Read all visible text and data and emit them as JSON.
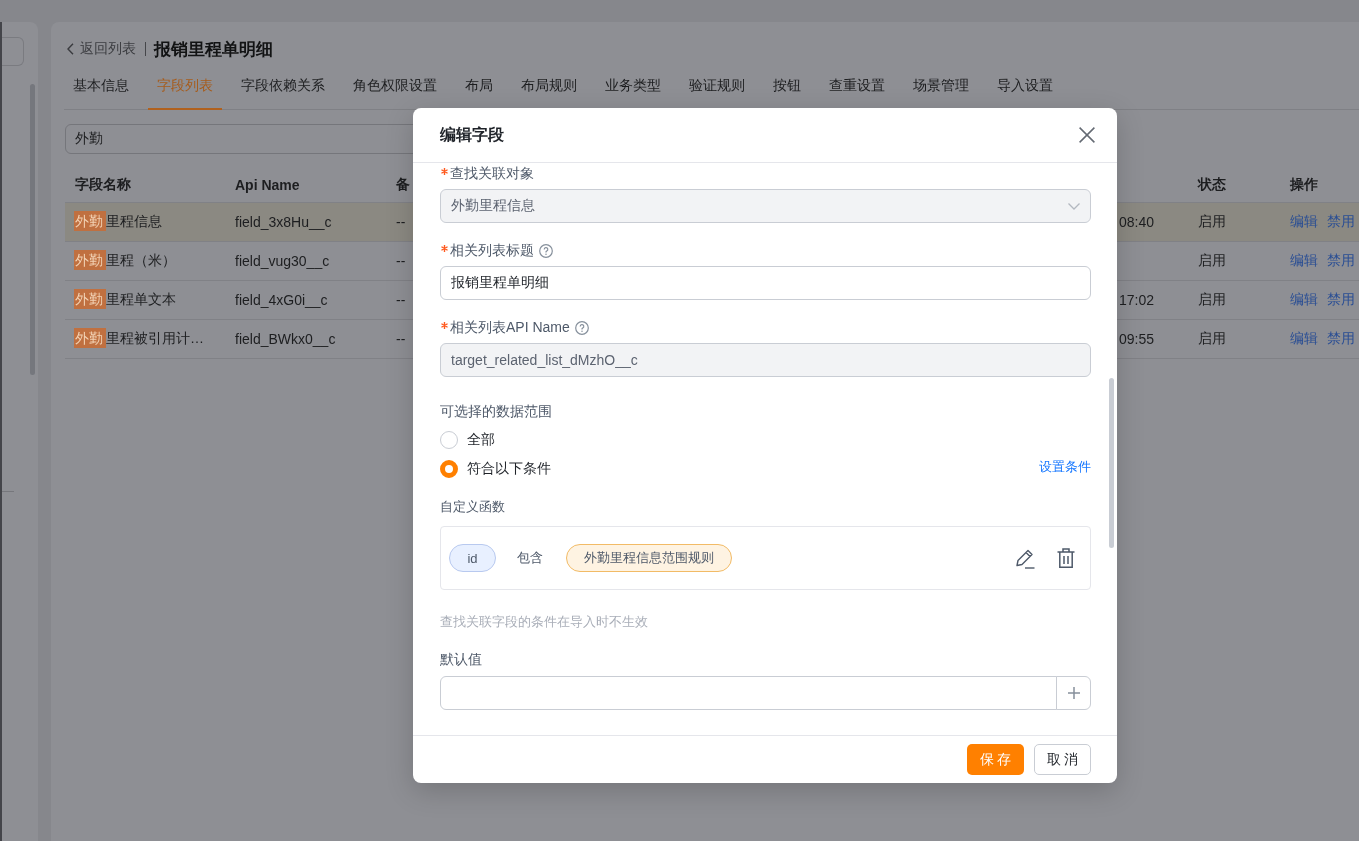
{
  "page": {
    "back_link": "返回列表",
    "title": "报销里程单明细",
    "tabs": [
      {
        "label": "基本信息",
        "selected": false
      },
      {
        "label": "字段列表",
        "selected": true
      },
      {
        "label": "字段依赖关系",
        "selected": false
      },
      {
        "label": "角色权限设置",
        "selected": false
      },
      {
        "label": "布局",
        "selected": false
      },
      {
        "label": "布局规则",
        "selected": false
      },
      {
        "label": "业务类型",
        "selected": false
      },
      {
        "label": "验证规则",
        "selected": false
      },
      {
        "label": "按钮",
        "selected": false
      },
      {
        "label": "查重设置",
        "selected": false
      },
      {
        "label": "场景管理",
        "selected": false
      },
      {
        "label": "导入设置",
        "selected": false
      }
    ],
    "search": {
      "value": "外勤"
    },
    "table": {
      "columns": [
        "字段名称",
        "Api Name",
        "备",
        "状态",
        "操作"
      ],
      "rows": [
        {
          "name": {
            "match": "外勤",
            "rest": "里程信息"
          },
          "api_name": "field_3x8Hu__c",
          "column_3": "--",
          "column_4": "08:40",
          "status": "启用",
          "actions": [
            "编辑",
            "禁用"
          ],
          "highlighted": true
        },
        {
          "name": {
            "match": "外勤",
            "rest": "里程（米）"
          },
          "api_name": "field_vug30__c",
          "column_3": "--",
          "status": "启用",
          "actions": [
            "编辑",
            "禁用"
          ],
          "highlighted": false
        },
        {
          "name": {
            "match": "外勤",
            "rest": "里程单文本"
          },
          "api_name": "field_4xG0i__c",
          "column_3": "--",
          "column_4": "17:02",
          "status": "启用",
          "actions": [
            "编辑",
            "禁用"
          ],
          "highlighted": false
        },
        {
          "name": {
            "match": "外勤",
            "rest": "里程被引用计…"
          },
          "api_name": "field_BWkx0__c",
          "column_3": "--",
          "column_4": "09:55",
          "status": "启用",
          "actions": [
            "编辑",
            "禁用"
          ],
          "highlighted": false
        }
      ]
    }
  },
  "dialog": {
    "title": "编辑字段",
    "fields": [
      {
        "kind": "select",
        "label": "查找关联对象",
        "required": true,
        "help": false,
        "value": "外勤里程信息",
        "disabled": true
      },
      {
        "kind": "input",
        "label": "相关列表标题",
        "required": true,
        "help": true,
        "value": "报销里程单明细",
        "disabled": false
      },
      {
        "kind": "input",
        "label": "相关列表API Name",
        "required": true,
        "help": true,
        "value": "target_related_list_dMzhO__c",
        "disabled": true
      }
    ],
    "data_range": {
      "label": "可选择的数据范围",
      "options": [
        {
          "label": "全部",
          "selected": false
        },
        {
          "label": "符合以下条件",
          "selected": true
        }
      ],
      "set_condition_link": "设置条件",
      "function_label": "自定义函数",
      "condition": {
        "field": "id",
        "operator": "包含",
        "value": "外勤里程信息范围规则"
      },
      "hint": "查找关联字段的条件在导入时不生效"
    },
    "default_value": {
      "label": "默认值"
    },
    "buttons": [
      {
        "label": "保 存",
        "kind": "primary"
      },
      {
        "label": "取 消",
        "kind": "default"
      }
    ]
  }
}
